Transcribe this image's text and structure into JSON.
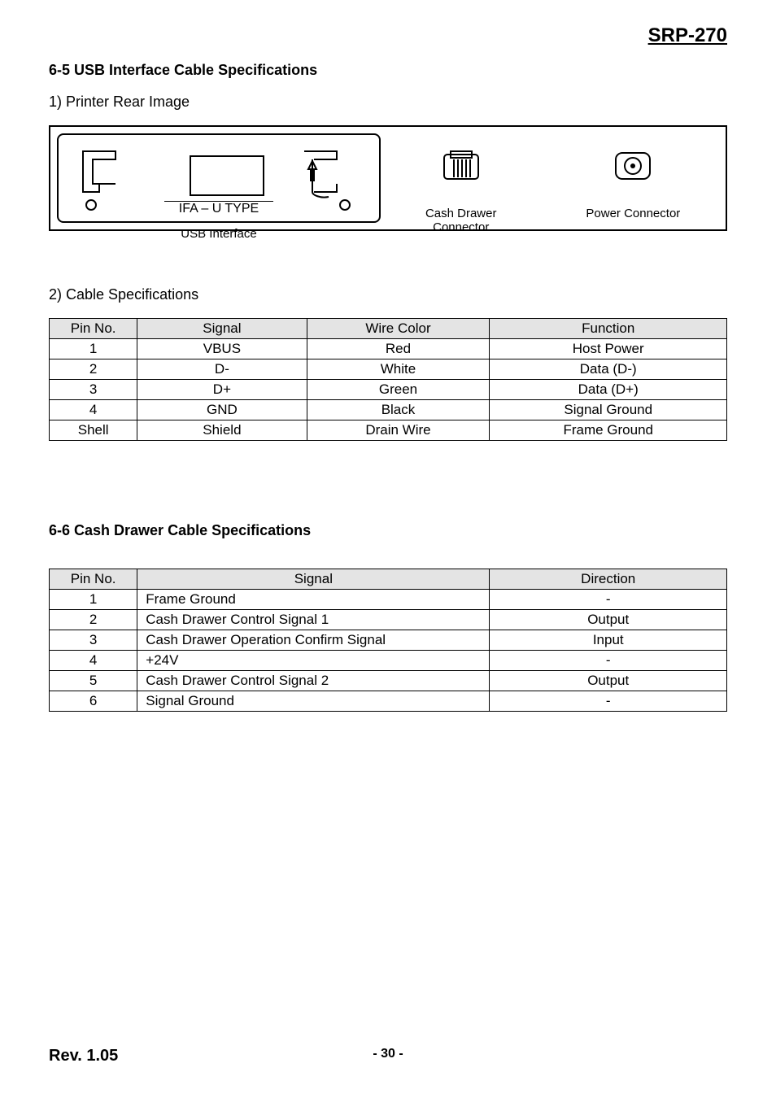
{
  "header": {
    "model": "SRP-270"
  },
  "section65": {
    "title": "6-5 USB Interface Cable Specifications",
    "sub1": "1) Printer Rear Image",
    "sub2": "2) Cable Specifications"
  },
  "diagram": {
    "ifa_type": "IFA – U TYPE",
    "usb_label": "USB Interface",
    "cash_label_line1": "Cash Drawer",
    "cash_label_line2": "Connector",
    "power_label": "Power Connector"
  },
  "table1": {
    "headers": [
      "Pin No.",
      "Signal",
      "Wire Color",
      "Function"
    ],
    "rows": [
      [
        "1",
        "VBUS",
        "Red",
        "Host Power"
      ],
      [
        "2",
        "D-",
        "White",
        "Data (D-)"
      ],
      [
        "3",
        "D+",
        "Green",
        "Data (D+)"
      ],
      [
        "4",
        "GND",
        "Black",
        "Signal Ground"
      ],
      [
        "Shell",
        "Shield",
        "Drain Wire",
        "Frame Ground"
      ]
    ]
  },
  "section66": {
    "title": "6-6 Cash Drawer Cable Specifications"
  },
  "table2": {
    "headers": [
      "Pin No.",
      "Signal",
      "Direction"
    ],
    "rows": [
      [
        "1",
        "Frame Ground",
        "-"
      ],
      [
        "2",
        "Cash Drawer Control Signal 1",
        "Output"
      ],
      [
        "3",
        "Cash Drawer Operation Confirm Signal",
        "Input"
      ],
      [
        "4",
        "+24V",
        "-"
      ],
      [
        "5",
        "Cash Drawer Control Signal 2",
        "Output"
      ],
      [
        "6",
        "Signal Ground",
        "-"
      ]
    ]
  },
  "footer": {
    "rev": "Rev. 1.05",
    "page": "- 30 -"
  }
}
